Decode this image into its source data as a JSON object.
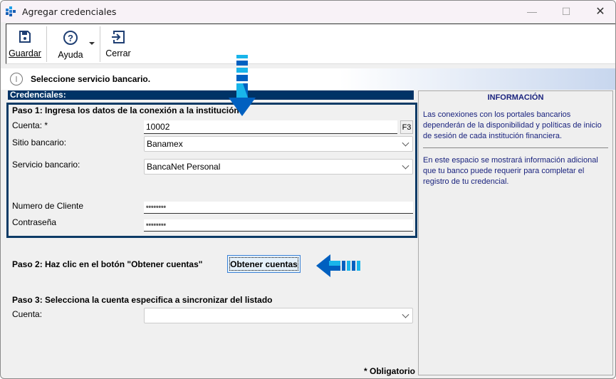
{
  "window": {
    "title": "Agregar credenciales"
  },
  "toolbar": {
    "guardar": "Guardar",
    "ayuda": "Ayuda",
    "cerrar": "Cerrar"
  },
  "status": {
    "message": "Seleccione servicio bancario."
  },
  "section_title": "Credenciales:",
  "paso1": {
    "title": "Paso 1: Ingresa los datos de la conexión a la institución",
    "cuenta_label": "Cuenta: *",
    "cuenta_value": "10002",
    "f3": "F3",
    "sitio_label": "Sitio bancario:",
    "sitio_value": "Banamex",
    "servicio_label": "Servicio bancario:",
    "servicio_value": "BancaNet Personal",
    "cliente_label": "Numero de Cliente",
    "cliente_value": "********",
    "password_label": "Contraseña",
    "password_value": "********"
  },
  "paso2": {
    "title": "Paso 2: Haz clic en el botón \"Obtener cuentas\"",
    "button": "Obtener cuentas"
  },
  "paso3": {
    "title": "Paso 3: Selecciona la cuenta especifica a sincronizar del listado",
    "cuenta_label": "Cuenta:",
    "cuenta_value": ""
  },
  "required_note": "* Obligatorio",
  "info": {
    "title": "INFORMACIÓN",
    "p1": "Las conexiones con los portales bancarios dependerán de la disponibilidad y políticas de inicio de sesión de cada institución financiera.",
    "p2": "En este espacio se mostrará información adicional que tu banco puede requerir para completar el registro de tu credencial."
  },
  "colors": {
    "navy": "#003366",
    "arrow_dark": "#0060c0",
    "arrow_light": "#19b5ea"
  }
}
